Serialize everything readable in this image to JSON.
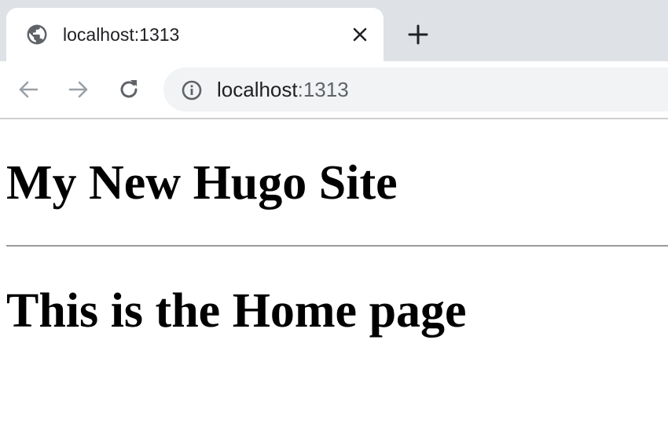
{
  "browser": {
    "tab": {
      "title": "localhost:1313",
      "icon": "globe-icon"
    },
    "new_tab_icon": "plus-icon",
    "close_icon": "close-icon",
    "nav": {
      "back_icon": "back-arrow-icon",
      "forward_icon": "forward-arrow-icon",
      "reload_icon": "reload-icon"
    },
    "address": {
      "host": "localhost",
      "port": ":1313",
      "icon": "info-icon"
    },
    "colors": {
      "tabstrip": "#dee1e6",
      "omnibox": "#f1f3f4",
      "icon": "#5f6368",
      "icon_disabled": "#9aa0a6"
    }
  },
  "page": {
    "site_title": "My New Hugo Site",
    "heading": "This is the Home page"
  }
}
